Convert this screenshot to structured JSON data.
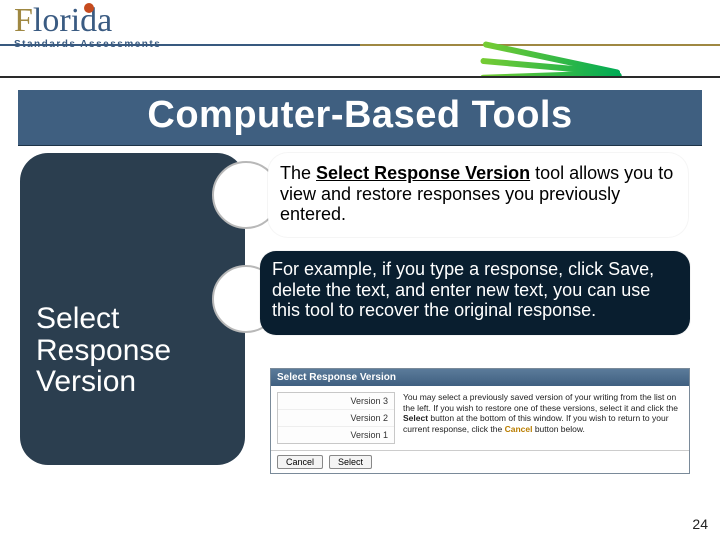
{
  "header": {
    "logo_main": "Florida",
    "logo_sub": "Standards Assessments"
  },
  "title": "Computer-Based Tools",
  "bubble1": {
    "pre": "The ",
    "highlight": "Select Response Version",
    "post": " tool allows you to view and restore responses you previously entered."
  },
  "bubble2": "For example, if you type a response, click Save, delete the text, and enter new text, you can use this tool to recover the original response.",
  "big_box": "Select Response Version",
  "dialog": {
    "title": "Select Response Version",
    "versions": [
      "Version 3",
      "Version 2",
      "Version 1"
    ],
    "instr_a": "You may select a previously saved version of your writing from the list on the left. If you wish to restore one of these versions, select it and click the ",
    "instr_sel": "Select",
    "instr_b": " button at the bottom of this window. If you wish to return to your current response, click the ",
    "instr_cancel": "Cancel",
    "instr_c": " button below.",
    "btn_cancel": "Cancel",
    "btn_select": "Select"
  },
  "page": "24"
}
